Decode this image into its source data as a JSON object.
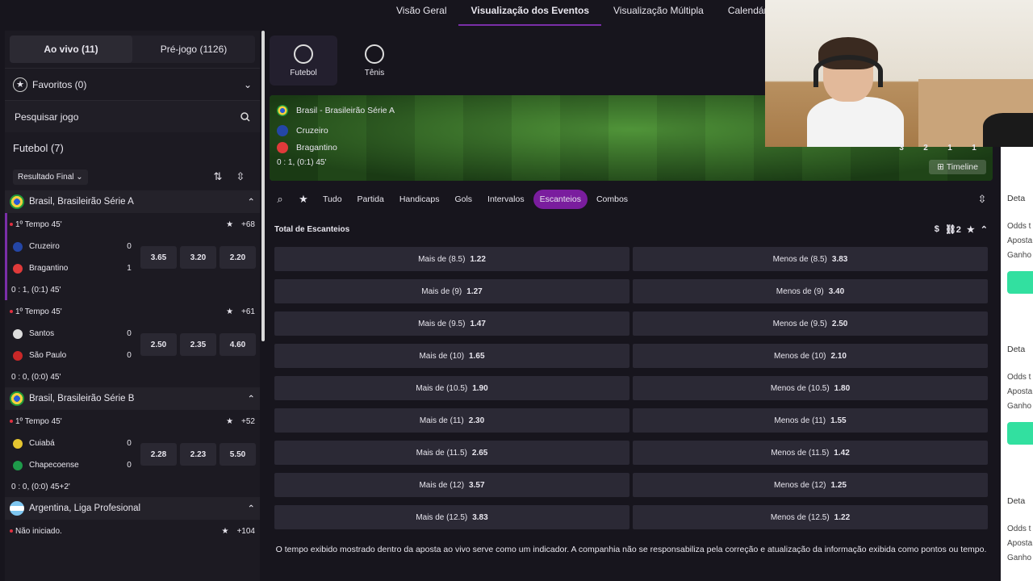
{
  "topnav": {
    "tabs": [
      "Visão Geral",
      "Visualização dos Eventos",
      "Visualização Múltipla",
      "Calendário E"
    ],
    "active_index": 1
  },
  "sidebar": {
    "live_tab": "Ao vivo (11)",
    "pre_tab": "Pré-jogo (1126)",
    "favorites": "Favoritos (0)",
    "search_placeholder": "Pesquisar jogo",
    "sport_title": "Futebol (7)",
    "filter": "Resultado Final",
    "leagues": [
      {
        "name": "Brasil, Brasileirão Série A"
      },
      {
        "name": "Brasil, Brasileirão Série B"
      },
      {
        "name": "Argentina, Liga Profesional"
      }
    ],
    "matches": [
      {
        "time": "1º Tempo 45'",
        "more": "+68",
        "home": "Cruzeiro",
        "home_score": "0",
        "away": "Bragantino",
        "away_score": "1",
        "odds": [
          "3.65",
          "3.20",
          "2.20"
        ],
        "score_line": "0 : 1, (0:1) 45'"
      },
      {
        "time": "1º Tempo 45'",
        "more": "+61",
        "home": "Santos",
        "home_score": "0",
        "away": "São Paulo",
        "away_score": "0",
        "odds": [
          "2.50",
          "2.35",
          "4.60"
        ],
        "score_line": "0 : 0, (0:0) 45'"
      },
      {
        "time": "1º Tempo 45'",
        "more": "+52",
        "home": "Cuiabá",
        "home_score": "0",
        "away": "Chapecoense",
        "away_score": "0",
        "odds": [
          "2.28",
          "2.23",
          "5.50"
        ],
        "score_line": "0 : 0, (0:0) 45+2'"
      },
      {
        "time": "Não iniciado.",
        "more": "+104"
      }
    ]
  },
  "center": {
    "sports": [
      "Futebol",
      "Tênis"
    ],
    "event": {
      "league": "Brasil - Brasileirão Série A",
      "home": "Cruzeiro",
      "away": "Bragantino",
      "score": "0 : 1, (0:1) 45'",
      "stat_numbers": [
        "3",
        "2",
        "1",
        "1"
      ],
      "timeline": "Timeline"
    },
    "filter_tabs": [
      "Tudo",
      "Partida",
      "Handicaps",
      "Gols",
      "Intervalos",
      "Escanteios",
      "Combos"
    ],
    "active_filter": "Escanteios",
    "market": {
      "title": "Total de Escanteios",
      "link_count": "2",
      "rows": [
        {
          "over": "Mais de (8.5)",
          "over_odd": "1.22",
          "under": "Menos de (8.5)",
          "under_odd": "3.83"
        },
        {
          "over": "Mais de (9)",
          "over_odd": "1.27",
          "under": "Menos de (9)",
          "under_odd": "3.40"
        },
        {
          "over": "Mais de (9.5)",
          "over_odd": "1.47",
          "under": "Menos de (9.5)",
          "under_odd": "2.50"
        },
        {
          "over": "Mais de (10)",
          "over_odd": "1.65",
          "under": "Menos de (10)",
          "under_odd": "2.10"
        },
        {
          "over": "Mais de (10.5)",
          "over_odd": "1.90",
          "under": "Menos de (10.5)",
          "under_odd": "1.80"
        },
        {
          "over": "Mais de (11)",
          "over_odd": "2.30",
          "under": "Menos de (11)",
          "under_odd": "1.55"
        },
        {
          "over": "Mais de (11.5)",
          "over_odd": "2.65",
          "under": "Menos de (11.5)",
          "under_odd": "1.42"
        },
        {
          "over": "Mais de (12)",
          "over_odd": "3.57",
          "under": "Menos de (12)",
          "under_odd": "1.25"
        },
        {
          "over": "Mais de (12.5)",
          "over_odd": "3.83",
          "under": "Menos de (12.5)",
          "under_odd": "1.22"
        }
      ]
    },
    "disclaimer": "O tempo exibido mostrado dentro da aposta ao vivo serve como um indicador. A companhia não se responsabiliza pela correção e atualização da informação exibida como pontos ou tempo."
  },
  "right_panel": {
    "blocks": [
      {
        "detail": "Deta",
        "lines": [
          "Odds t",
          "Aposta",
          "Ganho"
        ]
      },
      {
        "detail": "Deta",
        "lines": [
          "Odds t",
          "Aposta",
          "Ganho"
        ]
      },
      {
        "detail": "Deta",
        "lines": [
          "Odds t",
          "Aposta",
          "Ganho"
        ]
      }
    ]
  },
  "colors": {
    "accent": "#7a1d9e",
    "live_dot": "#e03040",
    "cta": "#32e0a0"
  }
}
